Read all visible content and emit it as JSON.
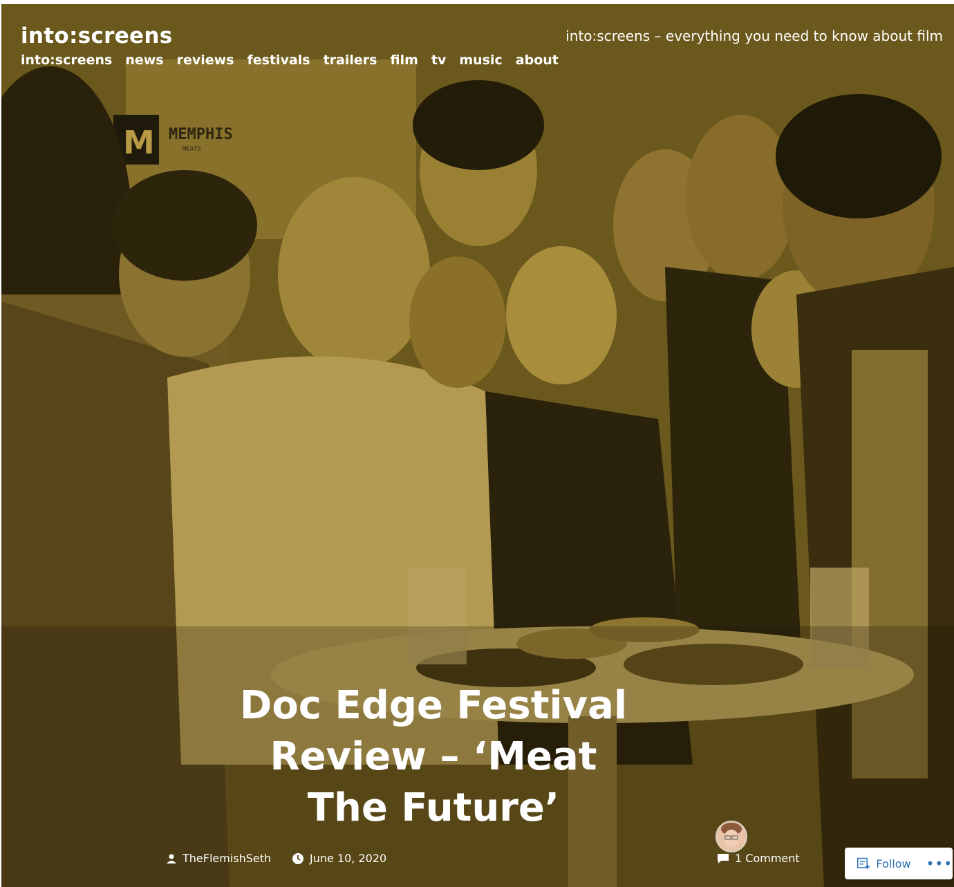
{
  "site": {
    "title": "into:screens",
    "tagline": "into:screens – everything you need to know about film"
  },
  "nav": {
    "items": [
      "into:screens",
      "news",
      "reviews",
      "festivals",
      "trailers",
      "film",
      "tv",
      "music",
      "about"
    ]
  },
  "hero_image": {
    "sign_text": "MEMPHIS",
    "sign_subtext": "MEATS",
    "sign_logo": "M"
  },
  "post": {
    "title": "Doc Edge Festival Review – ‘Meat The Future’",
    "title_lines": [
      "Doc Edge Festival",
      "Review – ‘Meat",
      "The Future’"
    ],
    "author": "TheFlemishSeth",
    "date": "June 10, 2020",
    "comments": "1 Comment"
  },
  "follow_widget": {
    "label": "Follow",
    "more": "•••"
  },
  "colors": {
    "overlay": "#6e5a1e",
    "text": "#ffffff",
    "follow_text": "#2a6fb5"
  },
  "icons": {
    "author": "person-icon",
    "date": "clock-icon",
    "comments": "comment-icon",
    "follow": "follow-reader-icon"
  }
}
